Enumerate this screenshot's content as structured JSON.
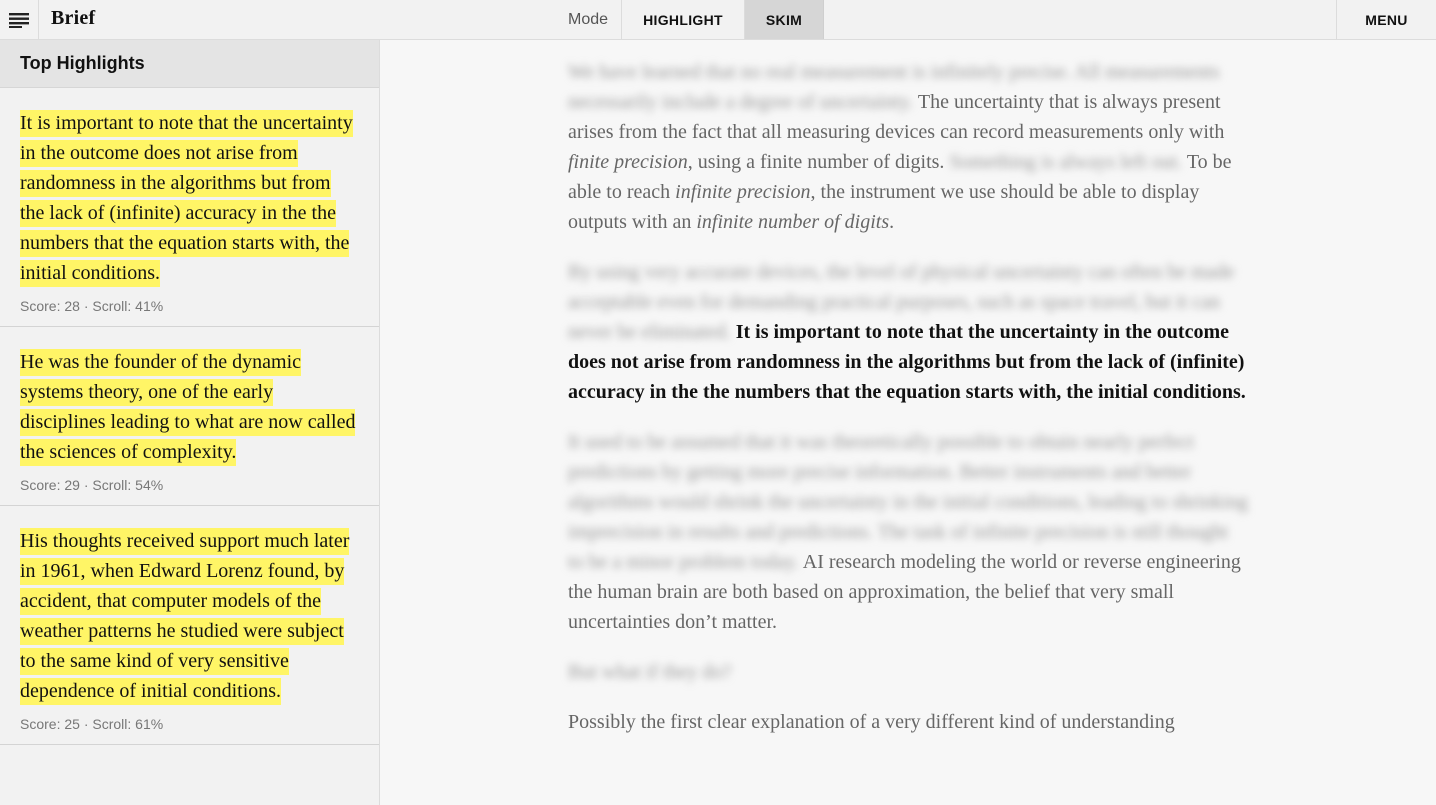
{
  "topbar": {
    "brand": "Brief",
    "mode_label": "Mode",
    "modes": [
      "HIGHLIGHT",
      "SKIM"
    ],
    "active_mode": "SKIM",
    "menu_label": "MENU",
    "menu_icon": "hamburger-icon"
  },
  "sidebar": {
    "title": "Top Highlights",
    "items": [
      {
        "text": "It is important to note that the uncertainty in the outcome does not arise from randomness in the algorithms but from the lack of (infinite) accuracy in the the numbers that the equation starts with, the initial conditions.",
        "meta": "Score: 28 · Scroll: 41%"
      },
      {
        "text": "He was the founder of the dynamic systems theory, one of the early disciplines leading to what are now called the sciences of complexity.",
        "meta": "Score: 29 · Scroll: 54%"
      },
      {
        "text": "His thoughts received support much later in 1961, when Edward Lorenz found, by accident, that computer models of the weather patterns he studied were subject to the same kind of very sensitive dependence of initial conditions.",
        "meta": "Score: 25 · Scroll: 61%"
      }
    ]
  },
  "article": {
    "p1_blur": "We have learned that no real measurement is infinitely precise. All measurements necessarily include a degree of uncertainty.",
    "p1_a": "The uncertainty that is always present arises from the fact that all measuring devices can record measurements only with ",
    "p1_em1": "finite precision",
    "p1_b": ", using a finite number of digits.",
    "p1_blur2": "Something is always left out.",
    "p1_c": "To be able to reach ",
    "p1_em2": "infinite precision",
    "p1_d": ", the instrument we use should be able to display outputs with an ",
    "p1_em3": "infinite number of digits",
    "p1_e": ".",
    "p2_blur": "By using very accurate devices, the level of physical uncertainty can often be made acceptable even for demanding practical purposes, such as space travel, but it can never be eliminated.",
    "p2_strong": "It is important to note that the uncertainty in the outcome does not arise from randomness in the algorithms but from the lack of (infinite) accuracy in the the numbers that the equation starts with, the initial conditions.",
    "p3_blur": "It used to be assumed that it was theoretically possible to obtain nearly perfect predictions by getting more precise information. Better instruments and better algorithms would shrink the uncertainty in the initial conditions, leading to shrinking imprecision in results and predictions. The task of infinite precision is still thought to be a minor problem today.",
    "p3_a": "AI research modeling the world or reverse engineering the human brain are both based on approximation, the belief that very small uncertainties don’t matter.",
    "p4_blur": "But what if they do?",
    "p5_a": "Possibly the first clear explanation of a very different kind of understanding"
  }
}
